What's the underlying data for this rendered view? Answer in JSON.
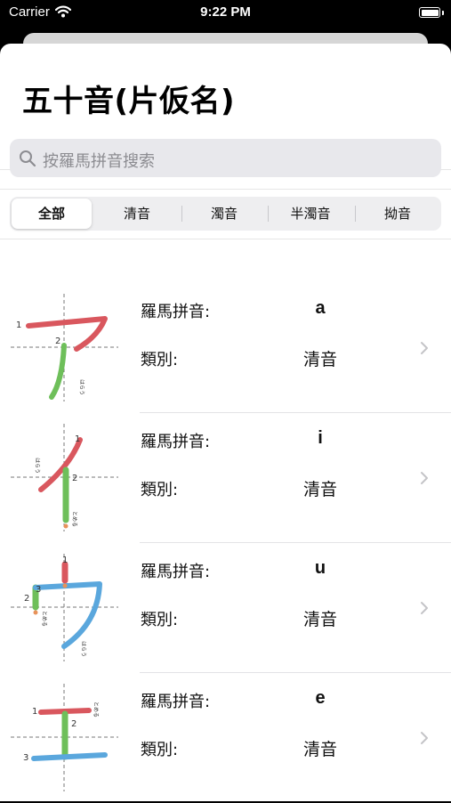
{
  "status_bar": {
    "carrier": "Carrier",
    "time": "9:22 PM"
  },
  "page": {
    "title": "五十音(片仮名)"
  },
  "search": {
    "placeholder": "按羅馬拼音搜索"
  },
  "segments": {
    "items": [
      "全部",
      "清音",
      "濁音",
      "半濁音",
      "拗音"
    ],
    "selected": "全部"
  },
  "labels": {
    "romaji": "羅馬拼音:",
    "category": "類別:"
  },
  "kana_list": [
    {
      "romaji": "a",
      "category": "清音",
      "stroke_hints": {
        "n1": "1",
        "n2": "2",
        "note": "はらう"
      }
    },
    {
      "romaji": "i",
      "category": "清音",
      "stroke_hints": {
        "n1": "1",
        "n2": "2",
        "note_a": "はらう",
        "note_b": "とめる"
      }
    },
    {
      "romaji": "u",
      "category": "清音",
      "stroke_hints": {
        "n1": "1",
        "n2": "2",
        "n3": "3",
        "note_a": "とめる",
        "note_b": "はらう"
      }
    },
    {
      "romaji": "e",
      "category": "清音",
      "stroke_hints": {
        "n1": "1",
        "n2": "2",
        "n3": "3",
        "note": "とめる"
      }
    }
  ],
  "colors": {
    "stroke1": "#d9575e",
    "stroke2": "#6ebf5a",
    "stroke3": "#5aa7dd",
    "accent": "#007aff"
  }
}
